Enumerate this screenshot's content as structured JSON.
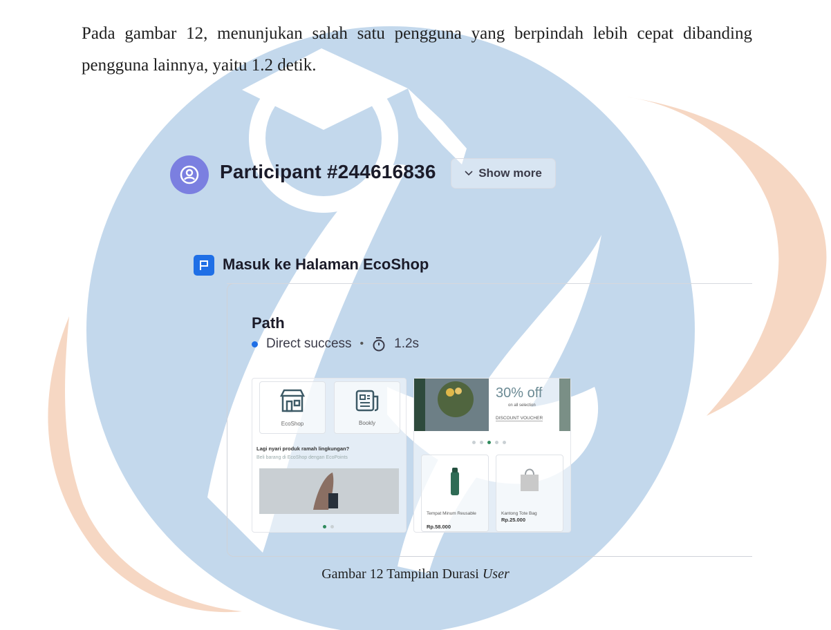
{
  "paragraph": "Pada gambar 12, menunjukan salah satu pengguna yang berpindah lebih cepat dibanding pengguna lainnya, yaitu 1.2 detik.",
  "figure": {
    "participant": "Participant #244616836",
    "show_more": "Show more",
    "task_title": "Masuk ke Halaman EcoShop",
    "path_label": "Path",
    "status": "Direct success",
    "separator": "•",
    "duration": "1.2s",
    "screen1": {
      "tiles": [
        {
          "label": "EcoShop",
          "icon": "store-icon"
        },
        {
          "label": "Bookly",
          "icon": "newspaper-icon"
        }
      ],
      "headline": "Lagi nyari produk ramah lingkungan?",
      "subline": "Beli barang di EcoShop dengan EcoPoints"
    },
    "screen2": {
      "promo": "30% off",
      "promo_sub": "on all selection",
      "voucher": "DISCOUNT VOUCHER",
      "products": [
        {
          "name": "Tempat Minum Reusable",
          "price": "Rp.58.000",
          "icon": "bottle-icon"
        },
        {
          "name": "Kantong Tote Bag",
          "price": "Rp.25.000",
          "icon": "tote-bag-icon"
        }
      ]
    }
  },
  "caption": {
    "prefix": "Gambar 12 Tampilan Durasi ",
    "italic": "User"
  },
  "colors": {
    "watermark_blue": "#c3d8ec",
    "watermark_peach": "#f6d7c3",
    "accent_blue": "#1f6fe6",
    "avatar_purple": "#7b7fe0"
  }
}
